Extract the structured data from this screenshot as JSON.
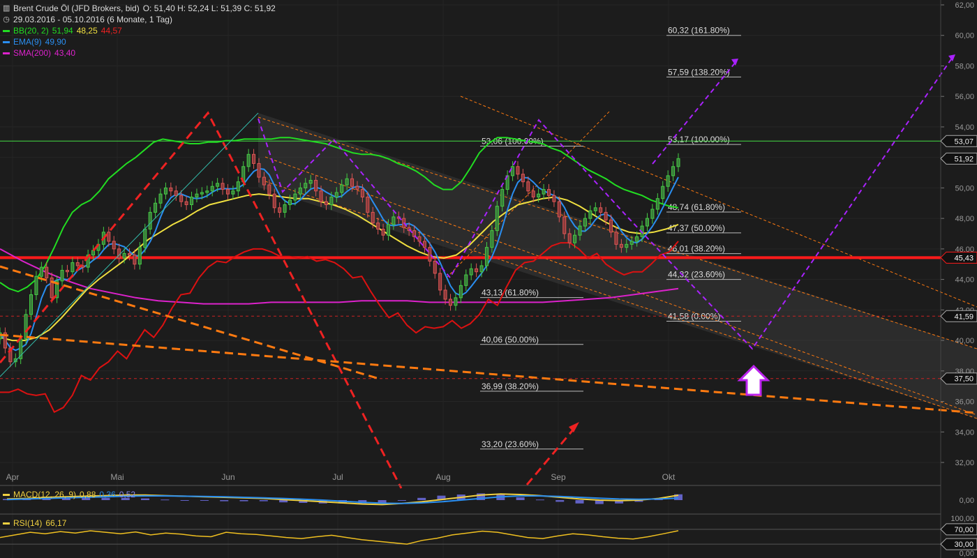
{
  "header": {
    "title": "Brent Crude Öl (JFD Brokers, bid)",
    "ohlc": "O: 51,40  H: 52,24  L: 51,39  C: 51,92",
    "period": "29.03.2016 - 05.10.2016 (6 Monate, 1 Tag)",
    "bb_label": "BB(20, 2)",
    "bb_mid": "51,94",
    "bb_upper": "48,25",
    "bb_lower": "44,57",
    "ema_label": "EMA(9)",
    "ema_value": "49,90",
    "sma_label": "SMA(200)",
    "sma_value": "43,40",
    "macd_label": "MACD(12, 26, 9)",
    "macd_v1": "0,88",
    "macd_v2": "0,36",
    "macd_v3": "0,52",
    "rsi_label": "RSI(14)",
    "rsi_value": "66,17"
  },
  "colors": {
    "background": "#1c1c1c",
    "bb": "#22dd22",
    "ema": "#2a8ef0",
    "sma": "#dd22cc",
    "bb_lower": "#dd1111",
    "bb_mid": "#f0e040",
    "support": "#ff1a1a",
    "trend": "#ff7a10",
    "projection": "#aa22ff",
    "candle_up": "#44cc44",
    "candle_down": "#dd5555"
  },
  "chart_data": {
    "type": "candlestick",
    "title": "Brent Crude Öl (JFD Brokers, bid)",
    "x_axis_labels": [
      "Apr",
      "Mai",
      "Jun",
      "Jul",
      "Aug",
      "Sep",
      "Okt"
    ],
    "y_ticks": [
      "62,00",
      "60,00",
      "58,00",
      "56,00",
      "54,00",
      "52,00",
      "50,00",
      "48,00",
      "46,00",
      "44,00",
      "42,00",
      "40,00",
      "38,00",
      "36,00",
      "34,00",
      "32,00"
    ],
    "ylim": [
      31,
      63
    ],
    "price_tags": [
      {
        "value": 53.07,
        "text": "53,07",
        "color": "#dddddd"
      },
      {
        "value": 51.92,
        "text": "51,92",
        "color": "#dddddd"
      },
      {
        "value": 45.43,
        "text": "45,43",
        "color": "#ff1a1a"
      },
      {
        "value": 41.59,
        "text": "41,59",
        "color": "#dddddd"
      },
      {
        "value": 37.5,
        "text": "37,50",
        "color": "#dddddd"
      }
    ],
    "fib_levels": [
      {
        "value": 60.32,
        "text": "60,32 (161.80%)"
      },
      {
        "value": 57.59,
        "text": "57,59 (138.20%)"
      },
      {
        "value": 53.17,
        "text": "53,17 (100.00%)"
      },
      {
        "value": 48.74,
        "text": "48,74 (61.80%)"
      },
      {
        "value": 47.37,
        "text": "47,37 (50.00%)"
      },
      {
        "value": 46.01,
        "text": "46,01 (38.20%)"
      },
      {
        "value": 44.32,
        "text": "44,32 (23.60%)"
      },
      {
        "value": 41.58,
        "text": "41,58 (0.00%)"
      }
    ],
    "retracement_levels": [
      {
        "value": 53.06,
        "text": "53,06 (100.00%)"
      },
      {
        "value": 43.13,
        "text": "43,13 (61.80%)"
      },
      {
        "value": 40.06,
        "text": "40,06 (50.00%)"
      },
      {
        "value": 36.99,
        "text": "36,99 (38.20%)"
      },
      {
        "value": 33.2,
        "text": "33,20 (23.60%)"
      }
    ],
    "close": [
      40.5,
      39.5,
      38.6,
      38.8,
      40.1,
      41.7,
      43.0,
      44.2,
      44.8,
      44.1,
      42.8,
      43.9,
      44.6,
      44.5,
      45.1,
      44.9,
      44.8,
      45.6,
      45.9,
      46.3,
      47.1,
      46.5,
      46.0,
      45.4,
      45.7,
      45.6,
      45.0,
      46.1,
      47.3,
      48.4,
      49.0,
      49.6,
      50.0,
      49.8,
      49.5,
      49.1,
      48.9,
      49.4,
      49.6,
      49.7,
      49.8,
      50.1,
      50.3,
      49.9,
      49.6,
      49.8,
      50.4,
      51.4,
      52.2,
      51.6,
      50.7,
      50.2,
      49.6,
      48.7,
      48.4,
      48.9,
      49.2,
      49.6,
      50.0,
      50.3,
      50.5,
      49.8,
      49.1,
      48.9,
      49.4,
      49.7,
      50.2,
      50.6,
      50.1,
      49.9,
      49.4,
      48.4,
      47.7,
      47.3,
      46.9,
      47.6,
      48.1,
      48.0,
      47.4,
      47.2,
      46.8,
      46.5,
      46.1,
      45.2,
      44.4,
      43.3,
      42.7,
      42.3,
      42.8,
      43.6,
      44.3,
      44.7,
      44.5,
      44.9,
      46.1,
      47.2,
      48.8,
      49.9,
      50.8,
      51.4,
      50.9,
      50.4,
      49.8,
      49.4,
      49.6,
      49.9,
      49.5,
      49.1,
      48.1,
      47.0,
      46.4,
      46.9,
      47.5,
      48.0,
      48.5,
      48.7,
      48.4,
      47.9,
      47.1,
      46.3,
      46.1,
      46.3,
      46.5,
      46.8,
      47.5,
      48.0,
      48.6,
      49.3,
      50.1,
      50.8,
      51.4,
      51.92
    ],
    "bb_upper": [
      43.8,
      43.4,
      43.2,
      43.5,
      44.0,
      44.9,
      46.1,
      47.4,
      48.4,
      48.9,
      49.2,
      49.8,
      50.6,
      51.1,
      51.6,
      52.0,
      52.5,
      53.0,
      53.2,
      53.1,
      53.0,
      52.9,
      52.9,
      53.0,
      53.0,
      53.1,
      53.1,
      53.2,
      53.2,
      53.2,
      53.2,
      53.3,
      53.3,
      53.2,
      53.1,
      53.0,
      52.9,
      52.7,
      52.5,
      52.3,
      52.2,
      52.2,
      52.1,
      51.9,
      51.6,
      51.4,
      51.1,
      50.7,
      50.2,
      49.9,
      49.9,
      50.4,
      51.3,
      52.3,
      52.9,
      53.3,
      53.3,
      53.2,
      53.1,
      53.0,
      52.9,
      52.6,
      52.4,
      52.0,
      51.6,
      51.2,
      50.9,
      50.6,
      50.2,
      49.9,
      49.7,
      49.5,
      49.2,
      49.0,
      48.8,
      48.7
    ],
    "bb_mid": [
      40.2,
      40.0,
      40.0,
      40.2,
      40.7,
      41.5,
      42.4,
      43.3,
      44.0,
      44.6,
      45.2,
      45.9,
      46.6,
      47.1,
      47.6,
      48.0,
      48.5,
      48.9,
      49.1,
      49.3,
      49.5,
      49.6,
      49.5,
      49.4,
      49.3,
      49.3,
      49.1,
      48.9,
      48.6,
      48.2,
      47.7,
      47.2,
      46.7,
      46.2,
      45.8,
      45.5,
      45.4,
      45.6,
      46.2,
      47.0,
      47.8,
      48.4,
      48.9,
      49.1,
      49.3,
      49.4,
      49.2,
      48.8,
      48.3,
      47.8,
      47.4,
      47.1,
      47.0,
      47.1,
      47.3,
      47.6
    ],
    "sma200": [
      46.0,
      45.2,
      44.5,
      43.9,
      43.4,
      43.1,
      42.8,
      42.6,
      42.5,
      42.4,
      42.4,
      42.4,
      42.5,
      42.5,
      42.5,
      42.5,
      42.6,
      42.6,
      42.6,
      42.5,
      42.5,
      42.5,
      42.5,
      42.5,
      42.5,
      42.6,
      42.7,
      42.8,
      43.0,
      43.2,
      43.4
    ],
    "macd": [
      0.2,
      0.3,
      0.5,
      0.6,
      0.7,
      0.8,
      0.9,
      0.9,
      0.8,
      0.7,
      0.6,
      0.5,
      0.4,
      0.3,
      0.1,
      -0.1,
      -0.3,
      -0.5,
      -0.7,
      -0.8,
      -0.6,
      -0.3,
      0.1,
      0.5,
      0.9,
      1.1,
      1.0,
      0.8,
      0.5,
      0.2,
      0.0,
      -0.1,
      0.0,
      0.3,
      0.88
    ],
    "macd_signal": [
      0.1,
      0.2,
      0.3,
      0.4,
      0.5,
      0.6,
      0.7,
      0.75,
      0.75,
      0.7,
      0.65,
      0.6,
      0.5,
      0.4,
      0.3,
      0.15,
      0.0,
      -0.2,
      -0.4,
      -0.55,
      -0.6,
      -0.5,
      -0.3,
      0.0,
      0.3,
      0.6,
      0.75,
      0.75,
      0.65,
      0.5,
      0.35,
      0.2,
      0.15,
      0.2,
      0.36
    ],
    "rsi": [
      48,
      55,
      62,
      58,
      64,
      60,
      66,
      62,
      58,
      63,
      55,
      60,
      57,
      52,
      50,
      62,
      58,
      56,
      52,
      48,
      45,
      50,
      54,
      48,
      42,
      38,
      34,
      30,
      40,
      46,
      55,
      60,
      65,
      62,
      55,
      48,
      45,
      52,
      58,
      55,
      50,
      46,
      44,
      50,
      58,
      66.17
    ],
    "rsi_ticks": [
      "100,00",
      "70,00",
      "30,00",
      "0,00"
    ],
    "macd_tick": "0,00"
  }
}
